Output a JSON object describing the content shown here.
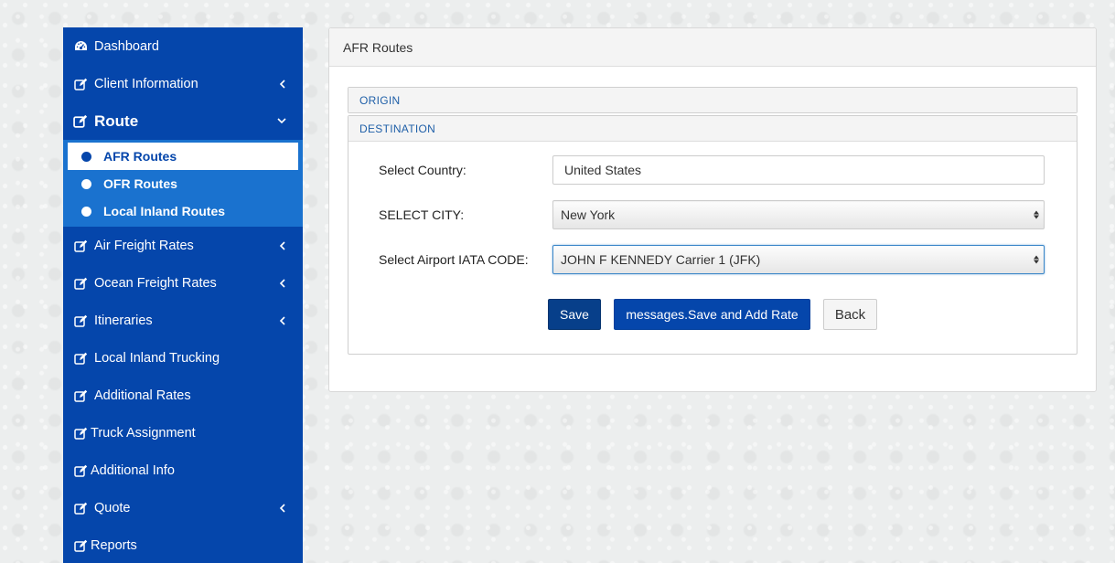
{
  "sidebar": {
    "items": [
      {
        "label": "Dashboard",
        "icon": "dashboard-icon"
      },
      {
        "label": "Client Information",
        "icon": "edit-icon",
        "has_chevron": "left"
      },
      {
        "label": "Route",
        "icon": "edit-icon",
        "has_chevron": "down",
        "expanded": true
      },
      {
        "label": "Air Freight Rates",
        "icon": "edit-icon",
        "has_chevron": "left"
      },
      {
        "label": "Ocean Freight Rates",
        "icon": "edit-icon",
        "has_chevron": "left"
      },
      {
        "label": "Itineraries",
        "icon": "edit-icon",
        "has_chevron": "left"
      },
      {
        "label": "Local Inland Trucking",
        "icon": "edit-icon"
      },
      {
        "label": "Additional Rates",
        "icon": "edit-icon"
      },
      {
        "label": "Truck Assignment",
        "icon": "edit-icon"
      },
      {
        "label": "Additional Info",
        "icon": "edit-icon"
      },
      {
        "label": "Quote",
        "icon": "edit-icon",
        "has_chevron": "left"
      },
      {
        "label": "Reports",
        "icon": "edit-icon"
      }
    ],
    "route_submenu": [
      {
        "label": "AFR Routes",
        "selected": true
      },
      {
        "label": "OFR Routes",
        "selected": false
      },
      {
        "label": "Local Inland Routes",
        "selected": false
      }
    ]
  },
  "main": {
    "panel_title": "AFR Routes",
    "sections": {
      "origin": "ORIGIN",
      "destination": "DESTINATION"
    },
    "form": {
      "country_label": "Select Country:",
      "country_value": "United States",
      "city_label": "SELECT CITY:",
      "city_value": "New York",
      "iata_label": "Select Airport IATA CODE:",
      "iata_value": "JOHN F KENNEDY Carrier 1 (JFK)"
    },
    "buttons": {
      "save": "Save",
      "save_add": "messages.Save and Add Rate",
      "back": "Back"
    }
  },
  "colors": {
    "sidebar_bg": "#0546ab",
    "submenu_bg": "#1a72cf",
    "accent_link": "#1f5fa8",
    "save_button": "#073f8a"
  }
}
